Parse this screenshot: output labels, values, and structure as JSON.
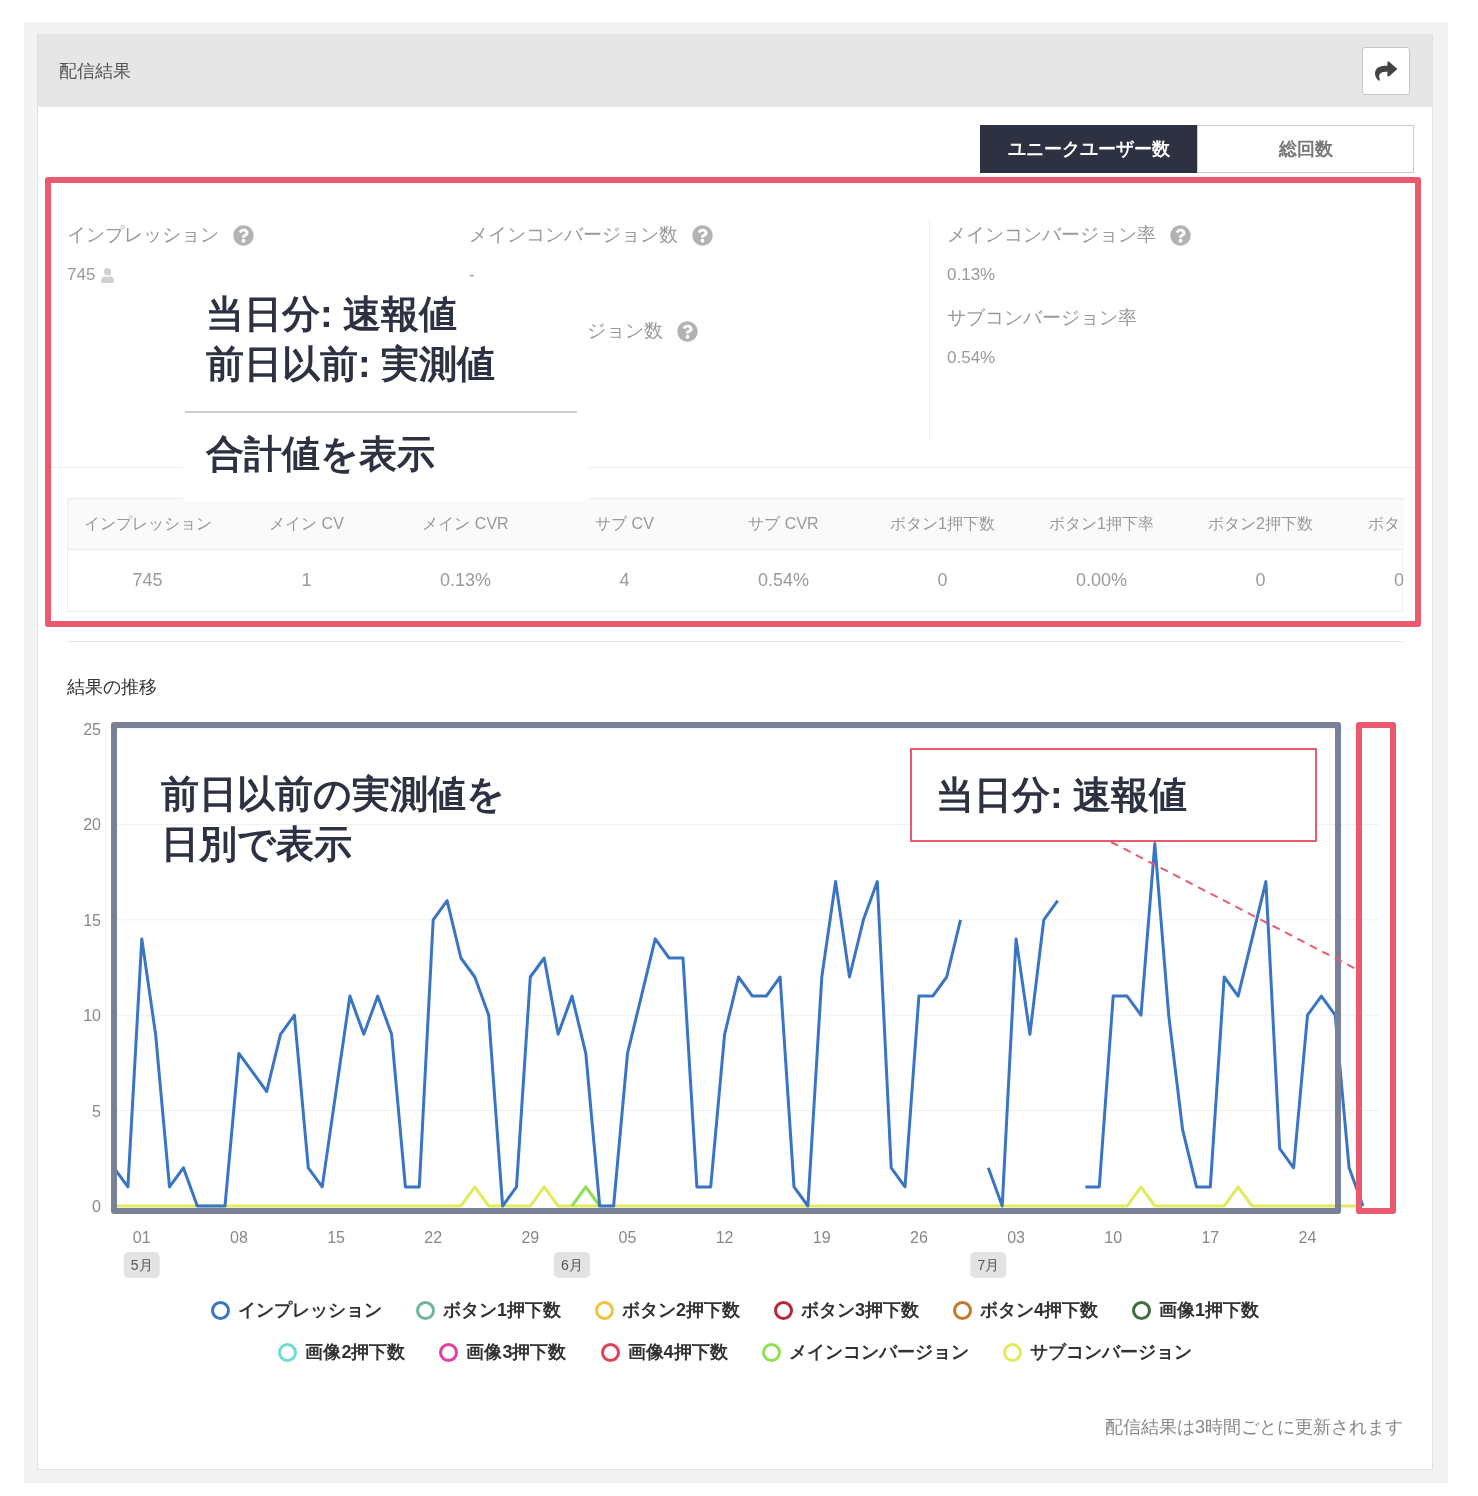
{
  "panel": {
    "title": "配信結果"
  },
  "toggle": [
    {
      "label": "ユニークユーザー数",
      "selected": true
    },
    {
      "label": "総回数",
      "selected": false
    }
  ],
  "summary": {
    "columns": [
      {
        "items": [
          {
            "kind": "full",
            "label": "インプレッション",
            "help": true,
            "value": "745",
            "user_icon": true
          }
        ]
      },
      {
        "items": [
          {
            "kind": "full",
            "label": "メインコンバージョン数",
            "help": true,
            "value": "-",
            "user_icon": false
          },
          {
            "kind": "covered",
            "label": "ジョン数",
            "help": true
          }
        ]
      },
      {
        "items": [
          {
            "kind": "full",
            "label": "メインコンバージョン率",
            "help": true,
            "value": "0.13%",
            "user_icon": false
          },
          {
            "kind": "full",
            "label": "サブコンバージョン率",
            "help": false,
            "value": "0.54%",
            "user_icon": false
          }
        ]
      }
    ]
  },
  "stats_note": {
    "lines": [
      "当日分: 速報値",
      "前日以前: 実測値"
    ],
    "caption": "合計値を表示"
  },
  "table": {
    "columns": [
      "インプレッション",
      "メイン CV",
      "メイン CVR",
      "サブ CV",
      "サブ CVR",
      "ボタン1押下数",
      "ボタン1押下率",
      "ボタン2押下数",
      "ボタ"
    ],
    "rows": [
      [
        "745",
        "1",
        "0.13%",
        "4",
        "0.54%",
        "0",
        "0.00%",
        "0",
        "0"
      ]
    ]
  },
  "results": {
    "title": "結果の推移",
    "chart_data": {
      "type": "line",
      "grid": true,
      "ylim": [
        -0.42,
        25
      ],
      "yticks": [
        0,
        5,
        10,
        15,
        20,
        25
      ],
      "annotations": [
        "5月",
        "6月",
        "7月"
      ],
      "categories": [
        null,
        null,
        "01",
        null,
        null,
        null,
        null,
        null,
        null,
        "08",
        null,
        null,
        null,
        null,
        null,
        null,
        "15",
        null,
        null,
        null,
        null,
        null,
        null,
        "22",
        null,
        null,
        null,
        null,
        null,
        null,
        "29",
        null,
        null,
        null,
        null,
        null,
        null,
        "05",
        null,
        null,
        null,
        null,
        null,
        null,
        "12",
        null,
        null,
        null,
        null,
        null,
        null,
        "19",
        null,
        null,
        null,
        null,
        null,
        null,
        "26",
        null,
        null,
        null,
        null,
        null,
        null,
        "03",
        null,
        null,
        null,
        null,
        null,
        null,
        "10",
        null,
        null,
        null,
        null,
        null,
        null,
        "17",
        null,
        null,
        null,
        null,
        null,
        null,
        "24",
        null,
        null,
        null,
        null
      ],
      "series": [
        {
          "name": "インプレッション",
          "color": "#3a75c4",
          "values": [
            2,
            1,
            14,
            9,
            1,
            2,
            0,
            0,
            0,
            8,
            7,
            6,
            9,
            10,
            2,
            1,
            6,
            11,
            9,
            11,
            9,
            1,
            1,
            15,
            16,
            13,
            12,
            10,
            0,
            1,
            12,
            13,
            9,
            11,
            8,
            0,
            0,
            8,
            11,
            14,
            13,
            13,
            1,
            1,
            9,
            12,
            11,
            11,
            12,
            1,
            0,
            12,
            17,
            12,
            15,
            17,
            2,
            1,
            11,
            11,
            12,
            15,
            null,
            2,
            0,
            14,
            9,
            15,
            16,
            null,
            1,
            1,
            11,
            11,
            10,
            19,
            10,
            4,
            1,
            1,
            12,
            11,
            14,
            17,
            3,
            2,
            10,
            11,
            10,
            2,
            0
          ]
        },
        {
          "name": "ボタン1押下数",
          "color": "#72b4a2",
          "values": [
            null,
            null,
            null,
            null,
            null,
            null,
            null,
            null,
            null,
            null,
            null,
            null,
            null,
            null,
            null,
            null,
            null,
            null,
            null,
            null,
            null,
            null,
            null,
            null,
            null,
            null,
            null,
            null,
            null,
            null,
            null,
            null,
            null,
            null,
            null,
            null,
            null,
            null,
            null,
            null,
            null,
            null,
            null,
            null,
            null,
            null,
            null,
            null,
            null,
            null,
            null,
            null,
            null,
            null,
            null,
            null,
            null,
            null,
            null,
            null,
            null,
            null,
            null,
            null,
            null,
            null,
            null,
            null,
            null,
            null,
            null,
            null,
            null,
            null,
            null,
            null,
            null,
            null,
            null,
            null,
            null,
            null,
            null,
            null,
            null,
            null,
            null,
            null,
            null,
            null,
            null
          ]
        },
        {
          "name": "ボタン2押下数",
          "color": "#f0c23e",
          "values": [
            null,
            null,
            null,
            null,
            null,
            null,
            null,
            null,
            null,
            null,
            null,
            null,
            null,
            null,
            null,
            null,
            null,
            null,
            null,
            null,
            null,
            null,
            null,
            null,
            null,
            null,
            null,
            null,
            null,
            null,
            null,
            null,
            null,
            null,
            null,
            null,
            null,
            null,
            null,
            null,
            null,
            null,
            null,
            null,
            null,
            null,
            null,
            null,
            null,
            null,
            null,
            null,
            null,
            null,
            null,
            null,
            null,
            null,
            null,
            null,
            null,
            null,
            null,
            null,
            null,
            null,
            null,
            null,
            null,
            null,
            null,
            null,
            null,
            null,
            null,
            null,
            null,
            null,
            null,
            null,
            null,
            null,
            null,
            null,
            null,
            null,
            null,
            null,
            null,
            null,
            null
          ]
        },
        {
          "name": "ボタン3押下数",
          "color": "#b5283c",
          "values": [
            null,
            null,
            null,
            null,
            null,
            null,
            null,
            null,
            null,
            null,
            null,
            null,
            null,
            null,
            null,
            null,
            null,
            null,
            null,
            null,
            null,
            null,
            null,
            null,
            null,
            null,
            null,
            null,
            null,
            null,
            null,
            null,
            null,
            null,
            null,
            null,
            null,
            null,
            null,
            null,
            null,
            null,
            null,
            null,
            null,
            null,
            null,
            null,
            null,
            null,
            null,
            null,
            null,
            null,
            null,
            null,
            null,
            null,
            null,
            null,
            null,
            null,
            null,
            null,
            null,
            null,
            null,
            null,
            null,
            null,
            null,
            null,
            null,
            null,
            null,
            null,
            null,
            null,
            null,
            null,
            null,
            null,
            null,
            null,
            null,
            null,
            null,
            null,
            null,
            null,
            null
          ]
        },
        {
          "name": "ボタン4押下数",
          "color": "#c07a2c",
          "values": [
            null,
            null,
            null,
            null,
            null,
            null,
            null,
            null,
            null,
            null,
            null,
            null,
            null,
            null,
            null,
            null,
            null,
            null,
            null,
            null,
            null,
            null,
            null,
            null,
            null,
            null,
            null,
            null,
            null,
            null,
            null,
            null,
            null,
            null,
            null,
            null,
            null,
            null,
            null,
            null,
            null,
            null,
            null,
            null,
            null,
            null,
            null,
            null,
            null,
            null,
            null,
            null,
            null,
            null,
            null,
            null,
            null,
            null,
            null,
            null,
            null,
            null,
            null,
            null,
            null,
            null,
            null,
            null,
            null,
            null,
            null,
            null,
            null,
            null,
            null,
            null,
            null,
            null,
            null,
            null,
            null,
            null,
            null,
            null,
            null,
            null,
            null,
            null,
            null,
            null,
            null
          ]
        },
        {
          "name": "画像1押下数",
          "color": "#3d6e3d",
          "values": [
            null,
            null,
            null,
            null,
            null,
            null,
            null,
            null,
            null,
            null,
            null,
            null,
            null,
            null,
            null,
            null,
            null,
            null,
            null,
            null,
            null,
            null,
            null,
            null,
            null,
            null,
            null,
            null,
            null,
            null,
            null,
            null,
            null,
            null,
            null,
            null,
            null,
            null,
            null,
            null,
            null,
            null,
            null,
            null,
            null,
            null,
            null,
            null,
            null,
            null,
            null,
            null,
            null,
            null,
            null,
            null,
            null,
            null,
            null,
            null,
            null,
            null,
            null,
            null,
            null,
            null,
            null,
            null,
            null,
            null,
            null,
            null,
            null,
            null,
            null,
            null,
            null,
            null,
            null,
            null,
            null,
            null,
            null,
            null,
            null,
            null,
            null,
            null,
            null,
            null,
            null
          ]
        },
        {
          "name": "画像2押下数",
          "color": "#6fdcd6",
          "values": [
            null,
            null,
            null,
            null,
            null,
            null,
            null,
            null,
            null,
            null,
            null,
            null,
            null,
            null,
            null,
            null,
            null,
            null,
            null,
            null,
            null,
            null,
            null,
            null,
            null,
            null,
            null,
            null,
            null,
            null,
            null,
            null,
            null,
            null,
            null,
            null,
            null,
            null,
            null,
            null,
            null,
            null,
            null,
            null,
            null,
            null,
            null,
            null,
            null,
            null,
            null,
            null,
            null,
            null,
            null,
            null,
            null,
            null,
            null,
            null,
            null,
            null,
            null,
            null,
            null,
            null,
            null,
            null,
            null,
            null,
            null,
            null,
            null,
            null,
            null,
            null,
            null,
            null,
            null,
            null,
            null,
            null,
            null,
            null,
            null,
            null,
            null,
            null,
            null,
            null,
            null
          ]
        },
        {
          "name": "画像3押下数",
          "color": "#e23fa2",
          "values": [
            null,
            null,
            null,
            null,
            null,
            null,
            null,
            null,
            null,
            null,
            null,
            null,
            null,
            null,
            null,
            null,
            null,
            null,
            null,
            null,
            null,
            null,
            null,
            null,
            null,
            null,
            null,
            null,
            null,
            null,
            null,
            null,
            null,
            null,
            null,
            null,
            null,
            null,
            null,
            null,
            null,
            null,
            null,
            null,
            null,
            null,
            null,
            null,
            null,
            null,
            null,
            null,
            null,
            null,
            null,
            null,
            null,
            null,
            null,
            null,
            null,
            null,
            null,
            null,
            null,
            null,
            null,
            null,
            null,
            null,
            null,
            null,
            null,
            null,
            null,
            null,
            null,
            null,
            null,
            null,
            null,
            null,
            null,
            null,
            null,
            null,
            null,
            null,
            null,
            null,
            null
          ]
        },
        {
          "name": "画像4押下数",
          "color": "#e23f58",
          "values": [
            null,
            null,
            null,
            null,
            null,
            null,
            null,
            null,
            null,
            null,
            null,
            null,
            null,
            null,
            null,
            null,
            null,
            null,
            null,
            null,
            null,
            null,
            null,
            null,
            null,
            null,
            null,
            null,
            null,
            null,
            null,
            null,
            null,
            null,
            null,
            null,
            null,
            null,
            null,
            null,
            null,
            null,
            null,
            null,
            null,
            null,
            null,
            null,
            null,
            null,
            null,
            null,
            null,
            null,
            null,
            null,
            null,
            null,
            null,
            null,
            null,
            null,
            null,
            null,
            null,
            null,
            null,
            null,
            null,
            null,
            null,
            null,
            null,
            null,
            null,
            null,
            null,
            null,
            null,
            null,
            null,
            null,
            null,
            null,
            null,
            null,
            null,
            null,
            null,
            null,
            null
          ]
        },
        {
          "name": "メインコンバージョン",
          "color": "#8ee052",
          "values": [
            null,
            null,
            null,
            null,
            null,
            null,
            null,
            null,
            null,
            null,
            null,
            null,
            null,
            null,
            null,
            null,
            null,
            null,
            null,
            null,
            null,
            null,
            null,
            null,
            null,
            null,
            null,
            null,
            null,
            null,
            null,
            null,
            null,
            0,
            1,
            0,
            null,
            null,
            null,
            null,
            null,
            null,
            null,
            null,
            null,
            null,
            null,
            null,
            null,
            null,
            null,
            null,
            null,
            null,
            null,
            null,
            null,
            null,
            null,
            null,
            null,
            null,
            null,
            null,
            null,
            null,
            null,
            null,
            null,
            null,
            null,
            null,
            null,
            null,
            null,
            null,
            null,
            null,
            null,
            null,
            null,
            null,
            null,
            null,
            null,
            null,
            null,
            null,
            null,
            null,
            null
          ]
        },
        {
          "name": "サブコンバージョン",
          "color": "#e2ea5e",
          "values": [
            0,
            0,
            0,
            0,
            0,
            0,
            0,
            0,
            0,
            0,
            0,
            0,
            0,
            0,
            0,
            0,
            0,
            0,
            0,
            0,
            0,
            0,
            0,
            0,
            0,
            0,
            1,
            0,
            0,
            0,
            0,
            1,
            0,
            0,
            0,
            0,
            0,
            0,
            0,
            0,
            0,
            0,
            0,
            0,
            0,
            0,
            0,
            0,
            0,
            0,
            0,
            0,
            0,
            0,
            0,
            0,
            0,
            0,
            0,
            0,
            0,
            0,
            0,
            0,
            0,
            0,
            0,
            0,
            0,
            0,
            0,
            0,
            0,
            0,
            1,
            0,
            0,
            0,
            0,
            0,
            0,
            1,
            0,
            0,
            0,
            0,
            0,
            0,
            0,
            0,
            0
          ]
        }
      ]
    },
    "notes": {
      "past": [
        "前日以前の実測値を",
        "日別で表示"
      ],
      "today": "当日分: 速報値"
    }
  },
  "footer": "配信結果は3時間ごとに更新されます"
}
